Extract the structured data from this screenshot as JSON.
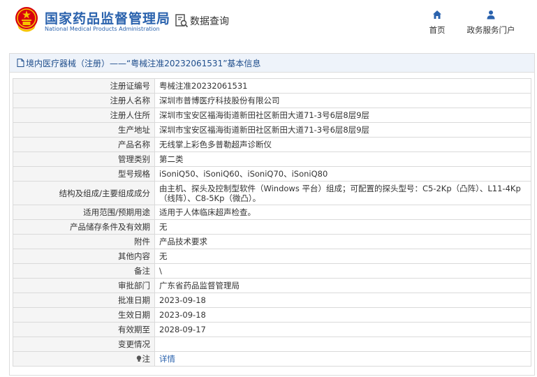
{
  "header": {
    "title": "国家药品监督管理局",
    "subtitle": "National Medical Products Administration",
    "query_label": "数据查询",
    "nav": {
      "home_label": "首页",
      "portal_label": "政务服务门户"
    }
  },
  "panel": {
    "heading": "境内医疗器械（注册）——“粤械注准20232061531”基本信息"
  },
  "rows": [
    {
      "label": "注册证编号",
      "value": "粤械注准20232061531"
    },
    {
      "label": "注册人名称",
      "value": "深圳市普博医疗科技股份有限公司"
    },
    {
      "label": "注册人住所",
      "value": "深圳市宝安区福海街道新田社区新田大道71-3号6层8层9层"
    },
    {
      "label": "生产地址",
      "value": "深圳市宝安区福海街道新田社区新田大道71-3号6层8层9层"
    },
    {
      "label": "产品名称",
      "value": "无线掌上彩色多普勒超声诊断仪"
    },
    {
      "label": "管理类别",
      "value": "第二类"
    },
    {
      "label": "型号规格",
      "value": "iSoniQ50、iSoniQ60、iSoniQ70、iSoniQ80"
    },
    {
      "label": "结构及组成/主要组成成分",
      "value": "由主机、探头及控制型软件（Windows 平台）组成；可配置的探头型号：C5-2Kp（凸阵）、L11-4Kp（线阵）、C8-5Kp（微凸）。"
    },
    {
      "label": "适用范围/预期用途",
      "value": "适用于人体临床超声检查。"
    },
    {
      "label": "产品储存条件及有效期",
      "value": "无"
    },
    {
      "label": "附件",
      "value": "产品技术要求"
    },
    {
      "label": "其他内容",
      "value": "无"
    },
    {
      "label": "备注",
      "value": "\\"
    },
    {
      "label": "审批部门",
      "value": "广东省药品监督管理局"
    },
    {
      "label": "批准日期",
      "value": "2023-09-18"
    },
    {
      "label": "生效日期",
      "value": "2023-09-18"
    },
    {
      "label": "有效期至",
      "value": "2028-09-17"
    },
    {
      "label": "变更情况",
      "value": ""
    }
  ],
  "note_row": {
    "label": "注",
    "link_text": "详情"
  },
  "colors": {
    "brand_blue": "#2a62ad",
    "emblem_red": "#d7000f",
    "emblem_gold": "#f6c300",
    "label_bg": "#f5f5f5",
    "head_bg": "#eef3fa"
  }
}
